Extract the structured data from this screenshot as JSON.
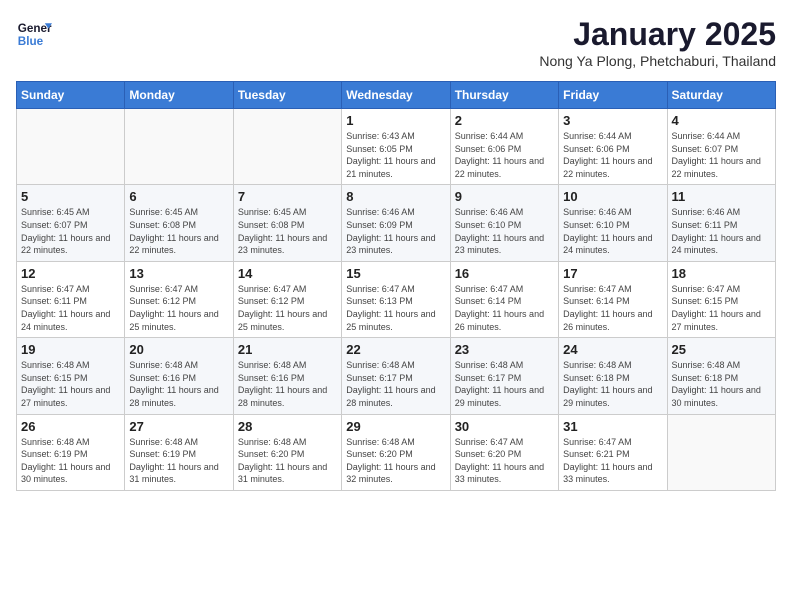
{
  "header": {
    "logo_line1": "General",
    "logo_line2": "Blue",
    "title": "January 2025",
    "location": "Nong Ya Plong, Phetchaburi, Thailand"
  },
  "weekdays": [
    "Sunday",
    "Monday",
    "Tuesday",
    "Wednesday",
    "Thursday",
    "Friday",
    "Saturday"
  ],
  "weeks": [
    [
      {
        "day": "",
        "info": ""
      },
      {
        "day": "",
        "info": ""
      },
      {
        "day": "",
        "info": ""
      },
      {
        "day": "1",
        "info": "Sunrise: 6:43 AM\nSunset: 6:05 PM\nDaylight: 11 hours and 21 minutes."
      },
      {
        "day": "2",
        "info": "Sunrise: 6:44 AM\nSunset: 6:06 PM\nDaylight: 11 hours and 22 minutes."
      },
      {
        "day": "3",
        "info": "Sunrise: 6:44 AM\nSunset: 6:06 PM\nDaylight: 11 hours and 22 minutes."
      },
      {
        "day": "4",
        "info": "Sunrise: 6:44 AM\nSunset: 6:07 PM\nDaylight: 11 hours and 22 minutes."
      }
    ],
    [
      {
        "day": "5",
        "info": "Sunrise: 6:45 AM\nSunset: 6:07 PM\nDaylight: 11 hours and 22 minutes."
      },
      {
        "day": "6",
        "info": "Sunrise: 6:45 AM\nSunset: 6:08 PM\nDaylight: 11 hours and 22 minutes."
      },
      {
        "day": "7",
        "info": "Sunrise: 6:45 AM\nSunset: 6:08 PM\nDaylight: 11 hours and 23 minutes."
      },
      {
        "day": "8",
        "info": "Sunrise: 6:46 AM\nSunset: 6:09 PM\nDaylight: 11 hours and 23 minutes."
      },
      {
        "day": "9",
        "info": "Sunrise: 6:46 AM\nSunset: 6:10 PM\nDaylight: 11 hours and 23 minutes."
      },
      {
        "day": "10",
        "info": "Sunrise: 6:46 AM\nSunset: 6:10 PM\nDaylight: 11 hours and 24 minutes."
      },
      {
        "day": "11",
        "info": "Sunrise: 6:46 AM\nSunset: 6:11 PM\nDaylight: 11 hours and 24 minutes."
      }
    ],
    [
      {
        "day": "12",
        "info": "Sunrise: 6:47 AM\nSunset: 6:11 PM\nDaylight: 11 hours and 24 minutes."
      },
      {
        "day": "13",
        "info": "Sunrise: 6:47 AM\nSunset: 6:12 PM\nDaylight: 11 hours and 25 minutes."
      },
      {
        "day": "14",
        "info": "Sunrise: 6:47 AM\nSunset: 6:12 PM\nDaylight: 11 hours and 25 minutes."
      },
      {
        "day": "15",
        "info": "Sunrise: 6:47 AM\nSunset: 6:13 PM\nDaylight: 11 hours and 25 minutes."
      },
      {
        "day": "16",
        "info": "Sunrise: 6:47 AM\nSunset: 6:14 PM\nDaylight: 11 hours and 26 minutes."
      },
      {
        "day": "17",
        "info": "Sunrise: 6:47 AM\nSunset: 6:14 PM\nDaylight: 11 hours and 26 minutes."
      },
      {
        "day": "18",
        "info": "Sunrise: 6:47 AM\nSunset: 6:15 PM\nDaylight: 11 hours and 27 minutes."
      }
    ],
    [
      {
        "day": "19",
        "info": "Sunrise: 6:48 AM\nSunset: 6:15 PM\nDaylight: 11 hours and 27 minutes."
      },
      {
        "day": "20",
        "info": "Sunrise: 6:48 AM\nSunset: 6:16 PM\nDaylight: 11 hours and 28 minutes."
      },
      {
        "day": "21",
        "info": "Sunrise: 6:48 AM\nSunset: 6:16 PM\nDaylight: 11 hours and 28 minutes."
      },
      {
        "day": "22",
        "info": "Sunrise: 6:48 AM\nSunset: 6:17 PM\nDaylight: 11 hours and 28 minutes."
      },
      {
        "day": "23",
        "info": "Sunrise: 6:48 AM\nSunset: 6:17 PM\nDaylight: 11 hours and 29 minutes."
      },
      {
        "day": "24",
        "info": "Sunrise: 6:48 AM\nSunset: 6:18 PM\nDaylight: 11 hours and 29 minutes."
      },
      {
        "day": "25",
        "info": "Sunrise: 6:48 AM\nSunset: 6:18 PM\nDaylight: 11 hours and 30 minutes."
      }
    ],
    [
      {
        "day": "26",
        "info": "Sunrise: 6:48 AM\nSunset: 6:19 PM\nDaylight: 11 hours and 30 minutes."
      },
      {
        "day": "27",
        "info": "Sunrise: 6:48 AM\nSunset: 6:19 PM\nDaylight: 11 hours and 31 minutes."
      },
      {
        "day": "28",
        "info": "Sunrise: 6:48 AM\nSunset: 6:20 PM\nDaylight: 11 hours and 31 minutes."
      },
      {
        "day": "29",
        "info": "Sunrise: 6:48 AM\nSunset: 6:20 PM\nDaylight: 11 hours and 32 minutes."
      },
      {
        "day": "30",
        "info": "Sunrise: 6:47 AM\nSunset: 6:20 PM\nDaylight: 11 hours and 33 minutes."
      },
      {
        "day": "31",
        "info": "Sunrise: 6:47 AM\nSunset: 6:21 PM\nDaylight: 11 hours and 33 minutes."
      },
      {
        "day": "",
        "info": ""
      }
    ]
  ]
}
